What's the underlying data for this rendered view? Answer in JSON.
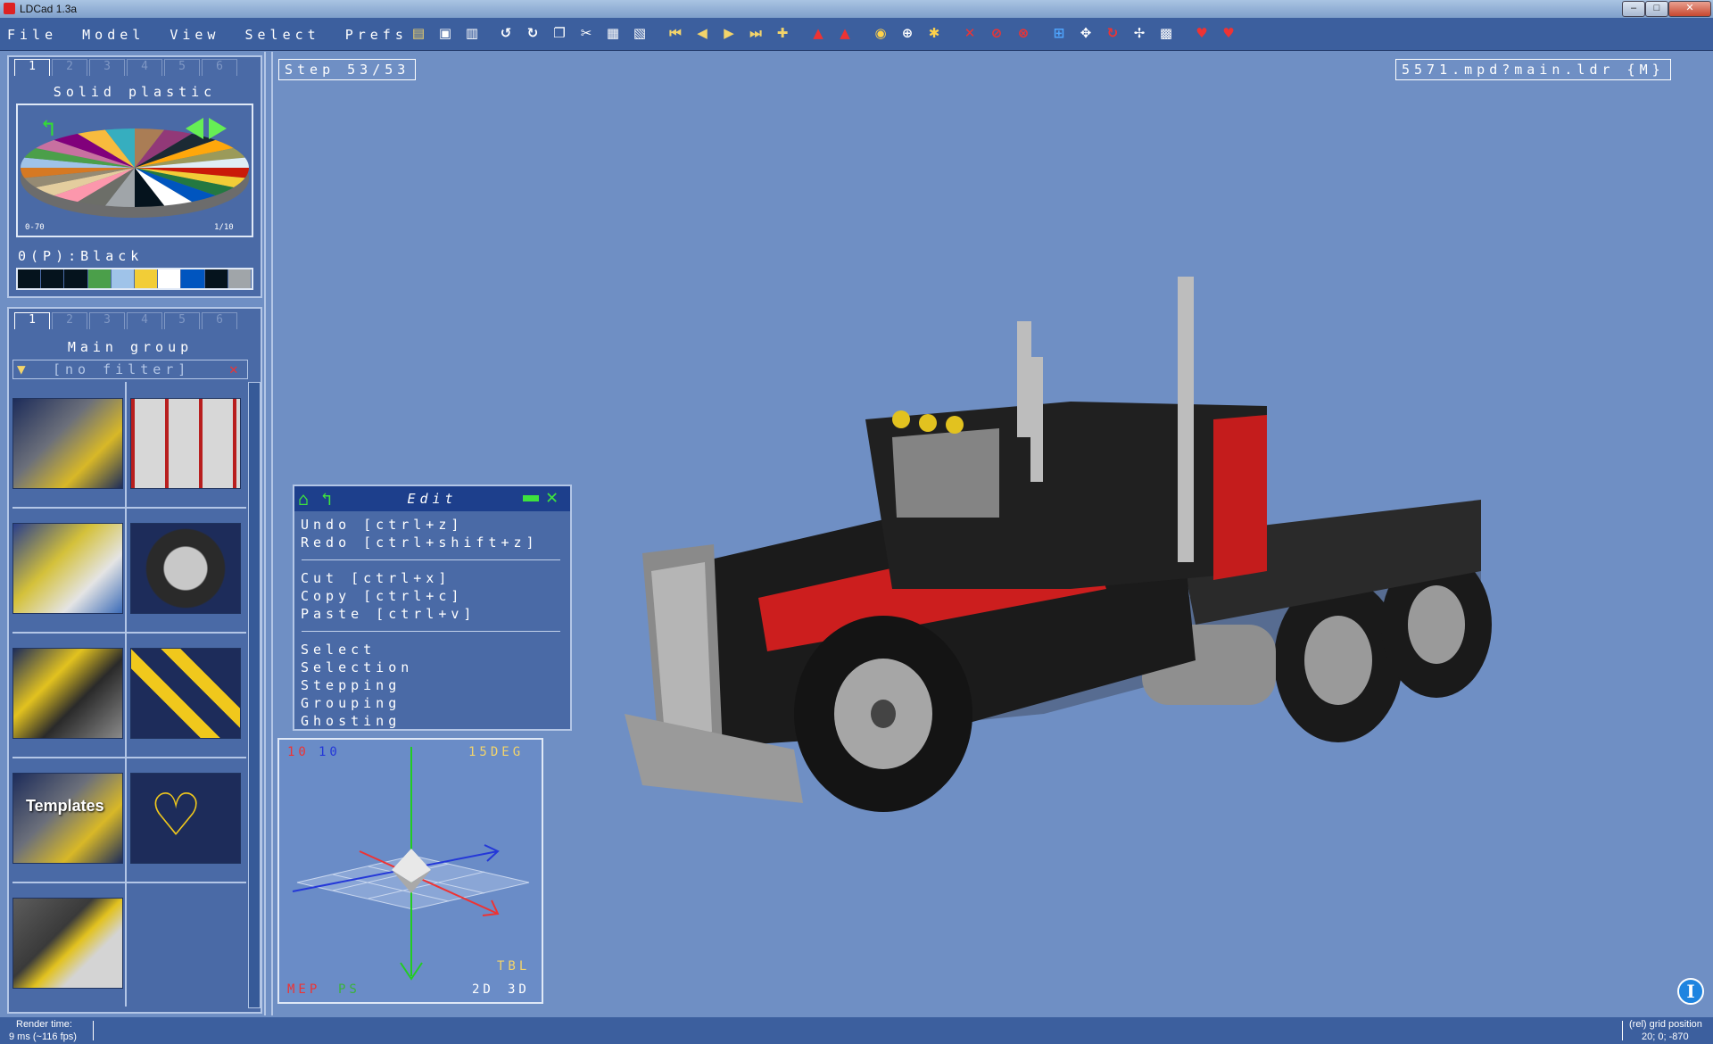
{
  "window": {
    "title": "LDCad 1.3a"
  },
  "menu": {
    "items": [
      "File",
      "Model",
      "View",
      "Select",
      "Prefs"
    ]
  },
  "color_panel": {
    "tabs": [
      "1",
      "2",
      "3",
      "4",
      "5",
      "6"
    ],
    "title": "Solid plastic",
    "range_left": "0-70",
    "range_right": "1/10",
    "current_color": "0(P):Black",
    "recent_colors": [
      "#05131d",
      "#05131d",
      "#05131d",
      "#4b9f4a",
      "#9fc3e9",
      "#f2cd37",
      "#ffffff",
      "#0055bf",
      "#05131d",
      "#a0a5a9"
    ]
  },
  "parts_panel": {
    "tabs": [
      "1",
      "2",
      "3",
      "4",
      "5",
      "6"
    ],
    "title": "Main group",
    "filter": "[no filter]",
    "templates_label": "Templates"
  },
  "viewport": {
    "step": "Step 53/53",
    "file": "5571.mpd?main.ldr {M}"
  },
  "edit_menu": {
    "title": "Edit",
    "items": [
      "Undo [ctrl+z]",
      "Redo [ctrl+shift+z]",
      "Cut [ctrl+x]",
      "Copy [ctrl+c]",
      "Paste [ctrl+v]",
      "Select",
      "Selection",
      "Stepping",
      "Grouping",
      "Ghosting"
    ]
  },
  "gizmo": {
    "grid_x": "10",
    "grid_y": "10",
    "angle": "15DEG",
    "mode_a": "MEP",
    "mode_b": "PS",
    "orient": "TBL",
    "dim_2d": "2D",
    "dim_3d": "3D"
  },
  "status": {
    "render_label": "Render time:",
    "render_value": "9 ms (~116 fps)",
    "grid_label": "(rel) grid position",
    "grid_value": "20; 0; -870"
  }
}
